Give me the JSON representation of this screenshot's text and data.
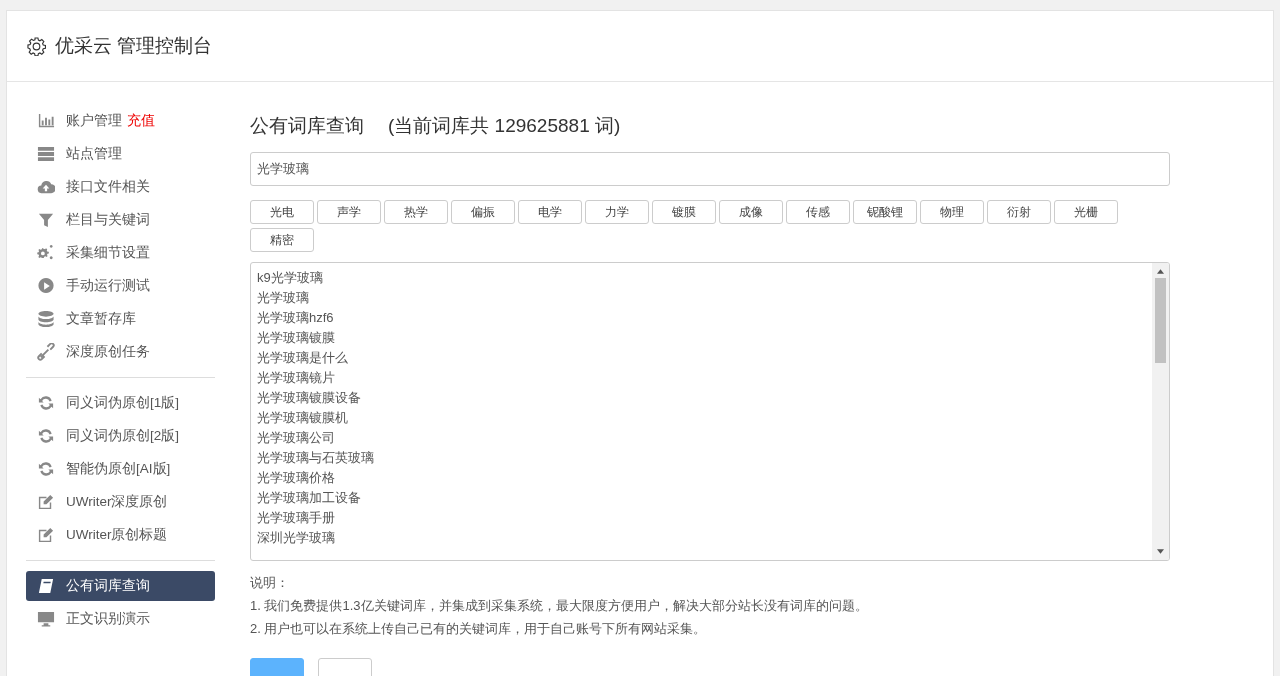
{
  "header": {
    "title": "优采云 管理控制台"
  },
  "sidebar": {
    "groups": [
      {
        "items": [
          {
            "label": "账户管理",
            "badge": "充值",
            "selected": false
          },
          {
            "label": "站点管理",
            "selected": false
          },
          {
            "label": "接口文件相关",
            "selected": false
          },
          {
            "label": "栏目与关键词",
            "selected": false
          },
          {
            "label": "采集细节设置",
            "selected": false
          },
          {
            "label": "手动运行测试",
            "selected": false
          },
          {
            "label": "文章暂存库",
            "selected": false
          },
          {
            "label": "深度原创任务",
            "selected": false
          }
        ]
      },
      {
        "items": [
          {
            "label": "同义词伪原创[1版]",
            "selected": false
          },
          {
            "label": "同义词伪原创[2版]",
            "selected": false
          },
          {
            "label": "智能伪原创[AI版]",
            "selected": false
          },
          {
            "label": "UWriter深度原创",
            "selected": false
          },
          {
            "label": "UWriter原创标题",
            "selected": false
          }
        ]
      },
      {
        "items": [
          {
            "label": "公有词库查询",
            "selected": true
          },
          {
            "label": "正文识别演示",
            "selected": false
          }
        ]
      }
    ]
  },
  "main": {
    "title": "公有词库查询",
    "count_note": "(当前词库共 129625881 词)",
    "search": {
      "value": "光学玻璃"
    },
    "tags": [
      "光电",
      "声学",
      "热学",
      "偏振",
      "电学",
      "力学",
      "镀膜",
      "成像",
      "传感",
      "铌酸锂",
      "物理",
      "衍射",
      "光栅",
      "精密"
    ],
    "results": [
      "k9光学玻璃",
      "光学玻璃",
      "光学玻璃hzf6",
      "光学玻璃镀膜",
      "光学玻璃是什么",
      "光学玻璃镜片",
      "光学玻璃镀膜设备",
      "光学玻璃镀膜机",
      "光学玻璃公司",
      "光学玻璃与石英玻璃",
      "光学玻璃价格",
      "光学玻璃加工设备",
      "光学玻璃手册",
      "深圳光学玻璃"
    ],
    "notes_heading": "说明：",
    "notes": [
      "1. 我们免费提供1.3亿关键词库，并集成到采集系统，最大限度方便用户，解决大部分站长没有词库的问题。",
      "2. 用户也可以在系统上传自己已有的关键词库，用于自己账号下所有网站采集。"
    ],
    "buttons": [
      {
        "kind": "primary"
      },
      {
        "kind": "default"
      }
    ]
  }
}
